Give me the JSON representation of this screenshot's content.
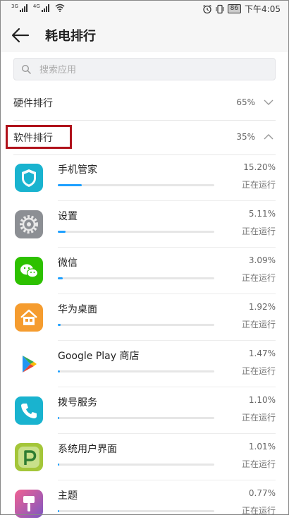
{
  "status_bar": {
    "signal1_type": "3G",
    "signal2_type": "4G",
    "battery": "86",
    "time": "下午4:05"
  },
  "header": {
    "title": "耗电排行"
  },
  "search": {
    "placeholder": "搜索应用"
  },
  "categories": [
    {
      "label": "硬件排行",
      "percent": "65%",
      "expanded": false
    },
    {
      "label": "软件排行",
      "percent": "35%",
      "expanded": true
    }
  ],
  "apps": [
    {
      "name": "手机管家",
      "percent": "15.20%",
      "status": "正在运行",
      "fraction": 0.152,
      "icon": "shield-icon",
      "color": "#19b3cf"
    },
    {
      "name": "设置",
      "percent": "5.11%",
      "status": "正在运行",
      "fraction": 0.0511,
      "icon": "settings-gear-icon",
      "color": "#8c8f94"
    },
    {
      "name": "微信",
      "percent": "3.09%",
      "status": "正在运行",
      "fraction": 0.0309,
      "icon": "wechat-icon",
      "color": "#2dc100"
    },
    {
      "name": "华为桌面",
      "percent": "1.92%",
      "status": "正在运行",
      "fraction": 0.0192,
      "icon": "home-icon",
      "color": "#f59c2f"
    },
    {
      "name": "Google Play 商店",
      "percent": "1.47%",
      "status": "正在运行",
      "fraction": 0.0147,
      "icon": "google-play-icon",
      "color": "#ffffff"
    },
    {
      "name": "拨号服务",
      "percent": "1.10%",
      "status": "正在运行",
      "fraction": 0.011,
      "icon": "phone-icon",
      "color": "#19b3cf"
    },
    {
      "name": "系统用户界面",
      "percent": "1.01%",
      "status": "正在运行",
      "fraction": 0.0101,
      "icon": "android-p-icon",
      "color": "#a4c639"
    },
    {
      "name": "主题",
      "percent": "0.77%",
      "status": "正在运行",
      "fraction": 0.0077,
      "icon": "theme-brush-icon",
      "color": "#e84a8a"
    }
  ],
  "colors": {
    "accent": "#1ea0ff",
    "highlight_box": "#b0121b"
  }
}
